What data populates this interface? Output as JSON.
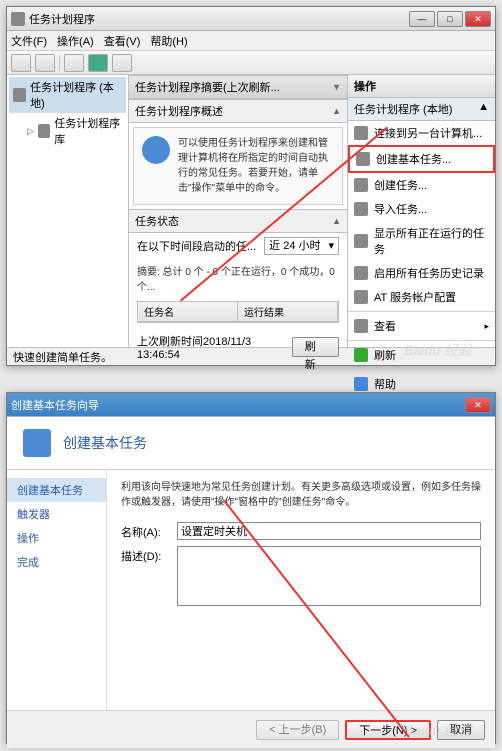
{
  "win1": {
    "title": "任务计划程序",
    "menu": [
      "文件(F)",
      "操作(A)",
      "查看(V)",
      "帮助(H)"
    ],
    "tree": {
      "root": "任务计划程序 (本地)",
      "child": "任务计划程序库"
    },
    "mid": {
      "overview_hdr": "任务计划程序摘要(上次刷新...",
      "overview_sub": "任务计划程序概述",
      "overview_txt": "可以使用任务计划程序来创建和管理计算机将在所指定的时间自动执行的常见任务。若要开始，请单击\"操作\"菜单中的命令。",
      "status_hdr": "任务状态",
      "status_lbl": "在以下时间段启动的任...",
      "status_combo": "近 24 小时",
      "summary": "摘要: 总计 0 个 - 0 个正在运行，0 个成功，0 个...",
      "col1": "任务名",
      "col2": "运行结果",
      "lastref": "上次刷新时间2018/11/3 13:46:54",
      "refresh_btn": "刷新"
    },
    "actions": {
      "hdr": "操作",
      "sub": "任务计划程序 (本地)",
      "items": [
        "连接到另一台计算机...",
        "创建基本任务...",
        "创建任务...",
        "导入任务...",
        "显示所有正在运行的任务",
        "启用所有任务历史记录",
        "AT 服务帐户配置",
        "查看",
        "刷新",
        "帮助"
      ]
    },
    "status": "快速创建简单任务。"
  },
  "win2": {
    "title": "创建基本任务向导",
    "head": "创建基本任务",
    "steps": [
      "创建基本任务",
      "触发器",
      "操作",
      "完成"
    ],
    "desc": "利用该向导快速地为常见任务创建计划。有关更多高级选项或设置，例如多任务操作或触发器，请使用\"操作\"窗格中的\"创建任务\"命令。",
    "name_lbl": "名称(A):",
    "name_val": "设置定时关机",
    "desc_lbl": "描述(D):",
    "btn_prev": "< 上一步(B)",
    "btn_next": "下一步(N) >",
    "btn_cancel": "取消"
  }
}
